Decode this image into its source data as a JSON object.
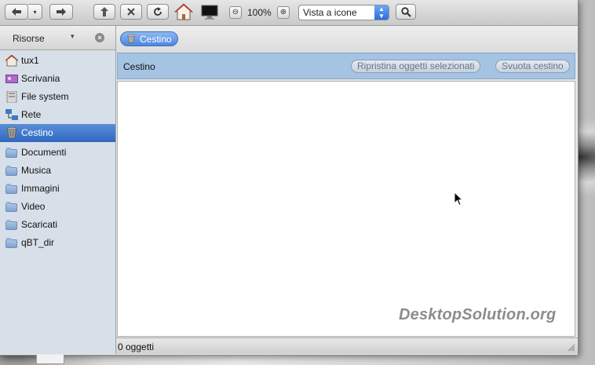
{
  "toolbar": {
    "zoom_level": "100%",
    "view_mode": "Vista a icone"
  },
  "sidebar": {
    "header_label": "Risorse",
    "items": [
      {
        "label": "tux1",
        "icon": "home-icon"
      },
      {
        "label": "Scrivania",
        "icon": "desktop-icon"
      },
      {
        "label": "File system",
        "icon": "drive-icon"
      },
      {
        "label": "Rete",
        "icon": "network-icon"
      },
      {
        "label": "Cestino",
        "icon": "trash-icon",
        "selected": true
      },
      {
        "label": "Documenti",
        "icon": "folder-icon"
      },
      {
        "label": "Musica",
        "icon": "folder-icon"
      },
      {
        "label": "Immagini",
        "icon": "folder-icon"
      },
      {
        "label": "Video",
        "icon": "folder-icon"
      },
      {
        "label": "Scaricati",
        "icon": "folder-icon"
      },
      {
        "label": "qBT_dir",
        "icon": "folder-icon"
      }
    ]
  },
  "pathbar": {
    "current": "Cestino"
  },
  "infobar": {
    "title": "Cestino",
    "restore_label": "Ripristina oggetti selezionati",
    "empty_label": "Svuota cestino"
  },
  "content": {
    "watermark": "DesktopSolution.org"
  },
  "status": {
    "text": "0 oggetti"
  },
  "colors": {
    "selection": "#3c74c8",
    "infobar": "#a5c3e2",
    "path_button": "#5a90e4"
  }
}
